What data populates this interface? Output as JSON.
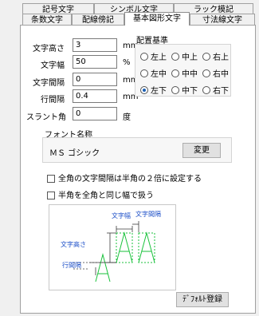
{
  "tabs_row1": [
    {
      "label": "記号文字"
    },
    {
      "label": "シンボル文字"
    },
    {
      "label": "ラック模記"
    }
  ],
  "tabs_row2": [
    {
      "label": "条数文字"
    },
    {
      "label": "配線傍記"
    },
    {
      "label": "基本図形文字"
    },
    {
      "label": "寸法線文字"
    }
  ],
  "fields": {
    "char_height": {
      "label": "文字高さ",
      "value": "3",
      "unit": "mm"
    },
    "char_width": {
      "label": "文字幅",
      "value": "50",
      "unit": "%"
    },
    "char_spacing": {
      "label": "文字間隔",
      "value": "0",
      "unit": "mm"
    },
    "line_spacing": {
      "label": "行間隔",
      "value": "0.4",
      "unit": "mm"
    },
    "slant": {
      "label": "スラント角",
      "value": "0",
      "unit": "度"
    }
  },
  "alignment": {
    "title": "配置基準",
    "options": [
      "左上",
      "中上",
      "右上",
      "左中",
      "中中",
      "右中",
      "左下",
      "中下",
      "右下"
    ],
    "selected": "左下"
  },
  "font": {
    "title": "フォント名称",
    "name": "ＭＳ ゴシック",
    "change_label": "変更"
  },
  "checkboxes": {
    "fullwidth_spacing": "全角の文字間隔は半角の２倍に設定する",
    "halfwidth_as_full": "半角を全角と同じ幅で扱う"
  },
  "preview": {
    "label_char_width": "文字幅",
    "label_char_spacing": "文字間隔",
    "label_char_height": "文字高さ",
    "label_line_spacing": "行間隔",
    "glyph": "A"
  },
  "default_button": "ﾃﾞﾌｫﾙﾄ登録",
  "colors": {
    "preview_green": "#19c23b",
    "radio_selected": "#1a5fb4"
  }
}
